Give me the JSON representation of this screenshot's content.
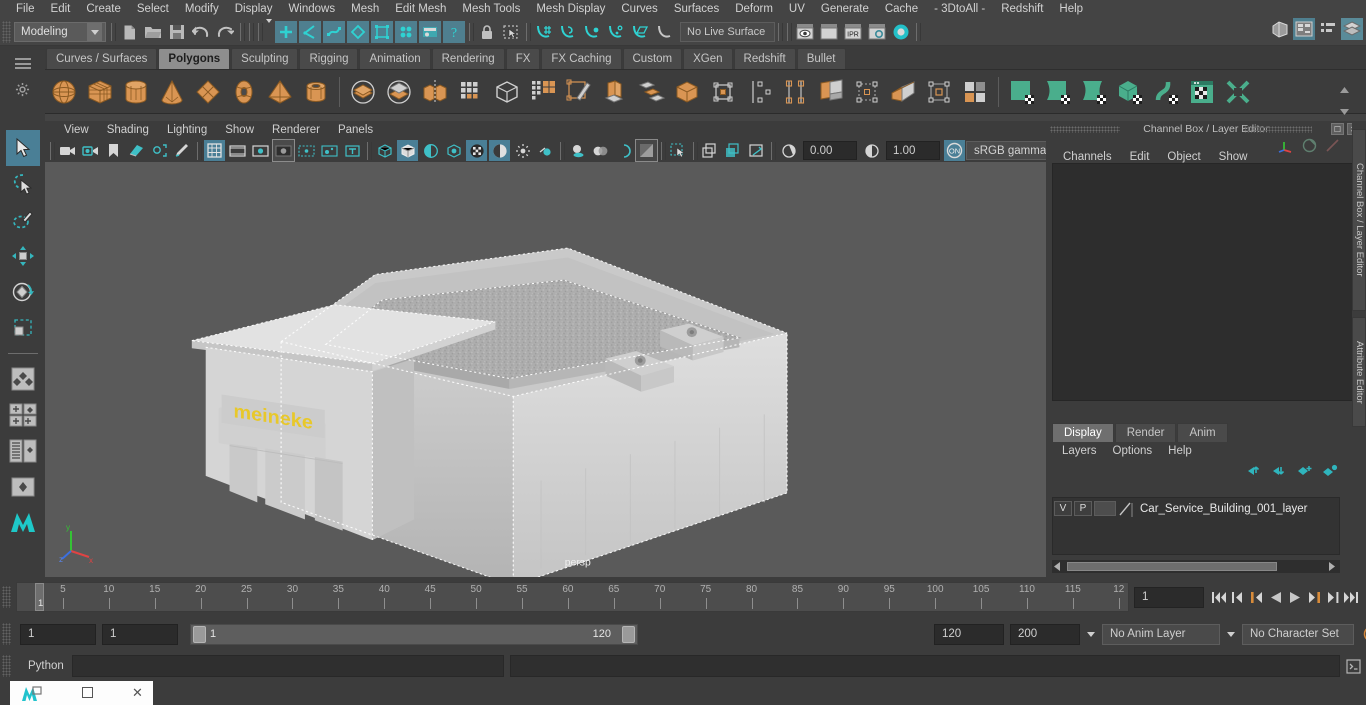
{
  "app": {
    "title": "Autodesk Maya",
    "menus": [
      "File",
      "Edit",
      "Create",
      "Select",
      "Modify",
      "Display",
      "Windows",
      "Mesh",
      "Edit Mesh",
      "Mesh Tools",
      "Mesh Display",
      "Curves",
      "Surfaces",
      "Deform",
      "UV",
      "Generate",
      "Cache",
      "- 3DtoAll -",
      "Redshift",
      "Help"
    ]
  },
  "status_line": {
    "mode": "Modeling",
    "live_surface": "No Live Surface",
    "icons": [
      "new-scene-icon",
      "open-scene-icon",
      "save-scene-icon",
      "undo-icon",
      "redo-icon",
      "select-by-hierarchy-icon",
      "select-by-object-icon",
      "select-by-component-icon",
      "select-vertex-icon",
      "select-edge-icon",
      "select-face-icon",
      "select-uv-icon",
      "select-help-icon",
      "lock-selection-icon",
      "marquee-select-icon",
      "snap-grid-icon",
      "snap-curve-icon",
      "snap-point-icon",
      "snap-projected-center-icon",
      "snap-view-plane-icon",
      "make-live-icon",
      "render-current-frame-icon",
      "render-sequence-icon",
      "ipr-render-icon",
      "render-settings-icon",
      "hypershade-icon",
      "show-hide-channel-box-icon",
      "show-hide-attribute-editor-icon",
      "show-hide-tool-settings-icon",
      "show-hide-layer-editor-icon"
    ]
  },
  "shelf": {
    "tabs": [
      "Curves / Surfaces",
      "Polygons",
      "Sculpting",
      "Rigging",
      "Animation",
      "Rendering",
      "FX",
      "FX Caching",
      "Custom",
      "XGen",
      "Redshift",
      "Bullet"
    ],
    "active_tab": "Polygons",
    "buttons": [
      "poly-sphere-icon",
      "poly-cube-icon",
      "poly-cylinder-icon",
      "poly-cone-icon",
      "poly-plane-icon",
      "poly-torus-icon",
      "poly-pyramid-icon",
      "poly-pipe-icon",
      "poly-booleans-icon",
      "poly-combine-icon",
      "poly-mirror-icon",
      "poly-smooth-icon",
      "poly-extrude-icon",
      "poly-multicut-icon",
      "poly-bevel-icon",
      "poly-bridge-icon",
      "poly-append-icon",
      "poly-target-weld-icon",
      "poly-connect-icon",
      "poly-chamfer-icon",
      "poly-quad-draw-icon",
      "poly-checker-icon",
      "uv-planar-icon",
      "uv-cylindrical-icon",
      "uv-spherical-icon",
      "uv-automatic-icon",
      "uv-unfold-icon",
      "uv-editor-icon",
      "uv-cut-icon"
    ]
  },
  "toolbox": {
    "tools": [
      {
        "name": "select-tool",
        "selected": true
      },
      {
        "name": "lasso-select-tool",
        "selected": false
      },
      {
        "name": "paint-select-tool",
        "selected": false
      },
      {
        "name": "move-tool",
        "selected": false
      },
      {
        "name": "rotate-tool",
        "selected": false
      },
      {
        "name": "scale-tool",
        "selected": false
      }
    ],
    "layouts": [
      "single-perspective-layout",
      "four-view-layout",
      "outliner-persp-layout",
      "hypergraph-persp-layout",
      "persp-graph-layout"
    ]
  },
  "viewport": {
    "menus": [
      "View",
      "Shading",
      "Lighting",
      "Show",
      "Renderer",
      "Panels"
    ],
    "camera_label": "persp",
    "exposure": "0.00",
    "gamma": "1.00",
    "color_space": "sRGB gamma",
    "view_gamma_toggle": "ON",
    "toolbar_icons": [
      "select-camera-icon",
      "camera-attributes-icon",
      "bookmark-icon",
      "image-plane-icon",
      "two-d-pan-zoom-icon",
      "grease-pencil-icon",
      "grid-toggle-icon",
      "film-gate-icon",
      "resolution-gate-icon",
      "gate-mask-icon",
      "film-origin-icon",
      "exposure-icon",
      "text-toggle-icon",
      "wireframe-icon",
      "smooth-shade-icon",
      "smooth-shade-all-icon",
      "flat-shade-icon",
      "wireframe-on-shaded-icon",
      "textured-icon",
      "use-default-lighting-icon",
      "use-all-lights-icon",
      "shadows-icon",
      "ambient-occlusion-icon",
      "motion-blur-icon",
      "multisample-icon",
      "isolate-select-icon",
      "xray-icon",
      "xray-joints-icon",
      "xray-active-components-icon",
      "exposure-icon",
      "gamma-icon",
      "view-transform-icon"
    ],
    "axis_labels": [
      "x",
      "y",
      "z"
    ]
  },
  "channel_box": {
    "title": "Channel Box / Layer Editor",
    "menus": [
      "Channels",
      "Edit",
      "Object",
      "Show"
    ],
    "side_tabs": [
      "Channel Box / Layer Editor",
      "Attribute Editor"
    ],
    "window_buttons": [
      "undock-icon",
      "close-icon"
    ],
    "header_icons": [
      "channel-box-icon",
      "anim-layer-icon",
      "deform-icon"
    ]
  },
  "layer_editor": {
    "tabs": [
      "Display",
      "Render",
      "Anim"
    ],
    "active_tab": "Display",
    "menus": [
      "Layers",
      "Options",
      "Help"
    ],
    "toolbar_icons": [
      "move-layer-up-icon",
      "move-layer-down-icon",
      "new-layer-icon",
      "new-layer-from-selected-icon"
    ],
    "layers": [
      {
        "visibility": "V",
        "playback": "P",
        "shading": "",
        "name": "Car_Service_Building_001_layer"
      }
    ]
  },
  "time_slider": {
    "current_frame": "1",
    "current_frame_field": "1",
    "tick_labels": [
      "5",
      "10",
      "15",
      "20",
      "25",
      "30",
      "35",
      "40",
      "45",
      "50",
      "55",
      "60",
      "65",
      "70",
      "75",
      "80",
      "85",
      "90",
      "95",
      "100",
      "105",
      "110",
      "115",
      "12"
    ],
    "playback_buttons": [
      "go-to-start-icon",
      "step-back-keyframe-icon",
      "step-back-frame-icon",
      "play-backwards-icon",
      "play-forwards-icon",
      "step-forward-frame-icon",
      "step-forward-keyframe-icon",
      "go-to-end-icon"
    ]
  },
  "range_slider": {
    "anim_start": "1",
    "range_start": "1",
    "range_bar_start": "1",
    "range_bar_end": "120",
    "range_end": "120",
    "anim_end": "200",
    "anim_layer": "No Anim Layer",
    "character_set": "No Character Set",
    "right_icons": [
      "auto-key-icon",
      "animation-preferences-icon"
    ]
  },
  "command_line": {
    "language_label": "Python",
    "input_value": "",
    "result_value": "",
    "script-editor-icon": "script-editor-icon"
  },
  "taskbar": {
    "app_icon": "maya-app-icon",
    "restore_icon": "restore-window-icon",
    "close_icon": "close-window-icon"
  }
}
